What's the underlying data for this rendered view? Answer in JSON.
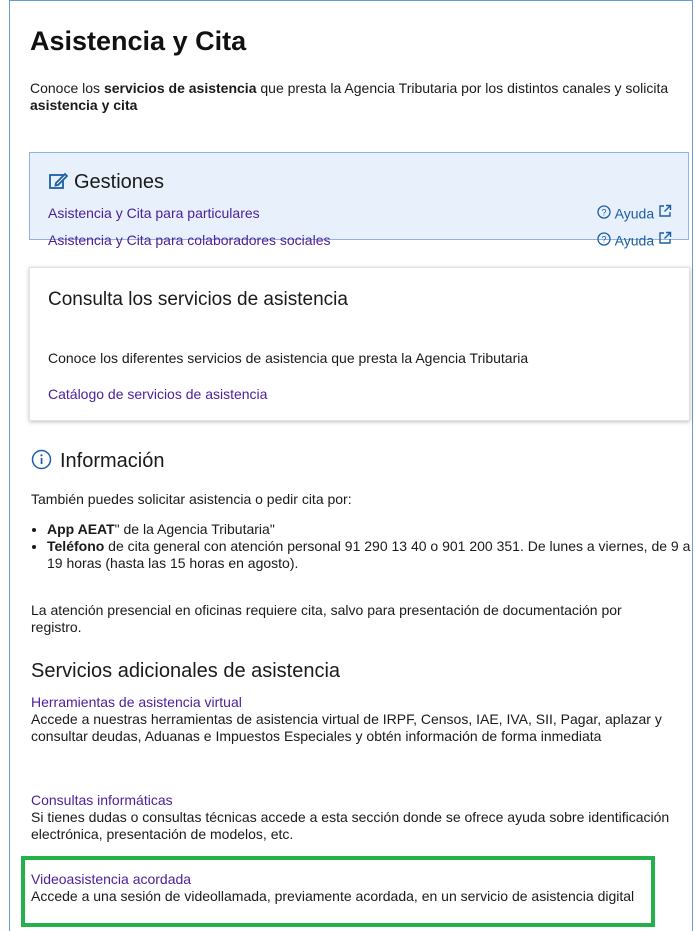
{
  "header": {
    "title": "Asistencia y Cita",
    "intro": {
      "p1": "Conoce los ",
      "b1": "servicios de asistencia",
      "p2": " que presta la Agencia Tributaria por los distintos canales y solicita ",
      "b2": "asistencia y cita"
    }
  },
  "gestiones": {
    "title": "Gestiones",
    "items": [
      {
        "label": "Asistencia y Cita para particulares",
        "help": "Ayuda"
      },
      {
        "label": "Asistencia y Cita para colaboradores sociales",
        "help": "Ayuda"
      }
    ]
  },
  "consulta": {
    "title": "Consulta los servicios de asistencia",
    "desc": "Conoce los diferentes servicios de asistencia que presta la Agencia Tributaria",
    "link": "Catálogo de servicios de asistencia"
  },
  "info": {
    "title": "Información",
    "lead": "También puedes solicitar asistencia o pedir cita por:",
    "bullets": [
      {
        "bold": "App AEAT",
        "rest": "\" de la Agencia Tributaria\""
      },
      {
        "bold": "Teléfono",
        "rest": " de cita general con atención personal 91 290 13 40 o 901 200 351. De lunes a viernes, de 9 a 19 horas (hasta las 15 horas en agosto)."
      }
    ],
    "note": "La atención presencial en oficinas requiere cita, salvo para presentación de documentación por registro."
  },
  "servicios": {
    "title": "Servicios adicionales de asistencia",
    "items": [
      {
        "link": "Herramientas de asistencia virtual",
        "desc": "Accede a nuestras herramientas de asistencia virtual de IRPF, Censos, IAE, IVA, SII, Pagar, aplazar y consultar deudas, Aduanas e Impuestos Especiales y obtén información de forma inmediata"
      },
      {
        "link": "Consultas informáticas",
        "desc": "Si tienes dudas o consultas técnicas accede a esta sección donde se ofrece ayuda sobre identificación electrónica, presentación de modelos, etc."
      },
      {
        "link": "Videoasistencia acordada",
        "desc": "Accede a una sesión de videollamada, previamente acordada, en un servicio de asistencia digital"
      }
    ]
  },
  "colors": {
    "link": "#4b1e9a",
    "help": "#1b5ea8",
    "highlight": "#24b04b",
    "panel_bg": "#e8f1fb"
  }
}
